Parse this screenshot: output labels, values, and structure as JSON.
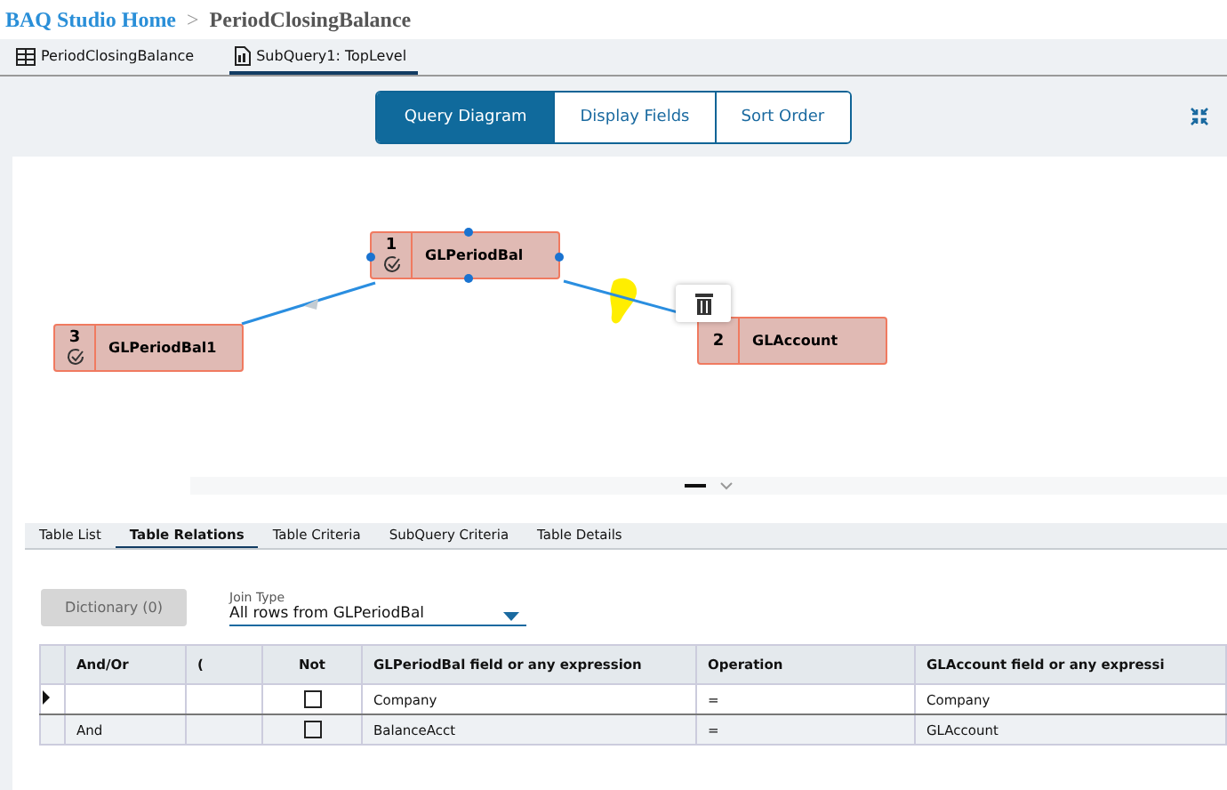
{
  "breadcrumb": {
    "home": "BAQ Studio Home",
    "separator": ">",
    "current": "PeriodClosingBalance"
  },
  "doc_tabs": [
    {
      "label": "PeriodClosingBalance",
      "kind": "grid",
      "selected": false
    },
    {
      "label": "SubQuery1: TopLevel",
      "kind": "doc",
      "selected": true
    }
  ],
  "view_buttons": [
    {
      "label": "Query Diagram",
      "selected": true
    },
    {
      "label": "Display Fields",
      "selected": false
    },
    {
      "label": "Sort Order",
      "selected": false
    }
  ],
  "diagram": {
    "nodes": [
      {
        "number": "1",
        "name": "GLPeriodBal",
        "selected": true
      },
      {
        "number": "3",
        "name": "GLPeriodBal1",
        "selected": false
      },
      {
        "number": "2",
        "name": "GLAccount",
        "selected": false
      }
    ]
  },
  "detail_tabs": [
    {
      "label": "Table List",
      "selected": false
    },
    {
      "label": "Table Relations",
      "selected": true
    },
    {
      "label": "Table Criteria",
      "selected": false
    },
    {
      "label": "SubQuery Criteria",
      "selected": false
    },
    {
      "label": "Table Details",
      "selected": false
    }
  ],
  "dictionary_button": {
    "label": "Dictionary (0)",
    "disabled": true
  },
  "join_type": {
    "label": "Join Type",
    "value": "All rows from GLPeriodBal"
  },
  "table": {
    "columns": [
      "And/Or",
      "(",
      "Not",
      "GLPeriodBal field or any expression",
      "Operation",
      "GLAccount field or any expressi"
    ],
    "rows": [
      {
        "current": true,
        "and_or": "",
        "paren": "",
        "not": false,
        "left": "Company",
        "operation": "=",
        "right": "Company"
      },
      {
        "current": false,
        "and_or": "And",
        "paren": "",
        "not": false,
        "left": "BalanceAcct",
        "operation": "=",
        "right": "GLAccount"
      }
    ]
  }
}
